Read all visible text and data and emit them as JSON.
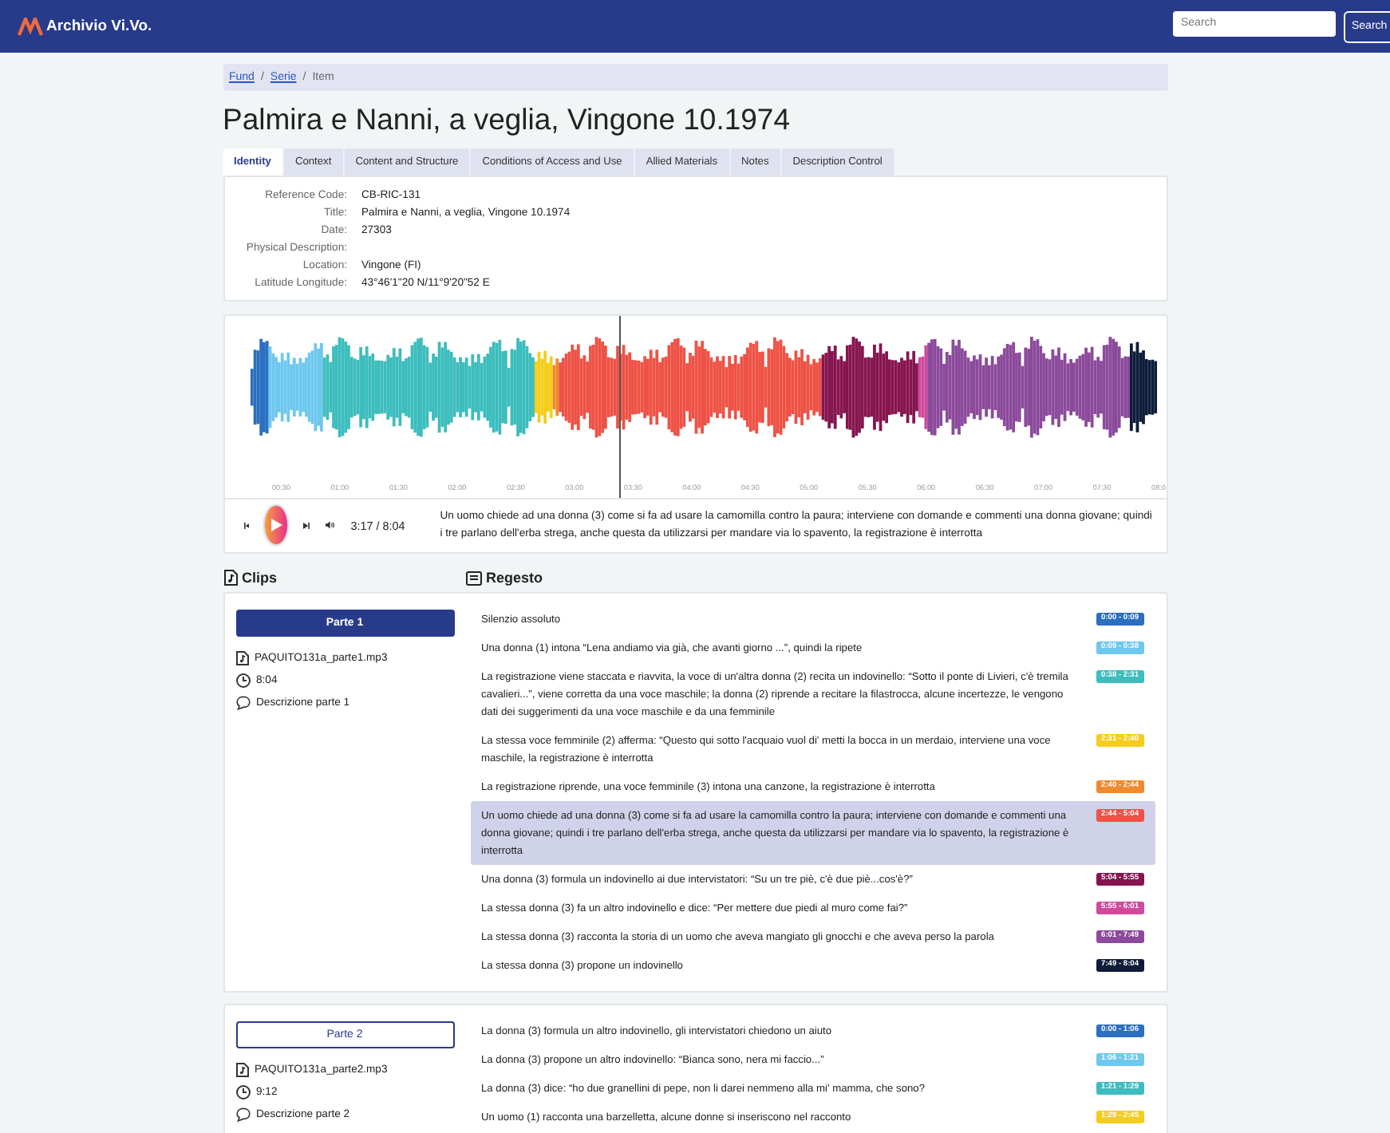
{
  "navbar": {
    "brand": "Archivio Vi.Vo.",
    "search": {
      "placeholder": "Search"
    },
    "search_button": "Search"
  },
  "breadcrumb": [
    {
      "label": "Fund",
      "link": true
    },
    {
      "separator": "/"
    },
    {
      "label": "Serie",
      "link": true
    },
    {
      "separator": "/"
    },
    {
      "label": "Item",
      "link": false
    }
  ],
  "title": "Palmira e Nanni, a veglia, Vingone 10.1974",
  "tabs": [
    {
      "label": "Identity",
      "selected": true
    },
    {
      "label": "Context",
      "selected": false
    },
    {
      "label": "Content and Structure",
      "selected": false
    },
    {
      "label": "Conditions of Access and Use",
      "selected": false
    },
    {
      "label": "Allied Materials",
      "selected": false
    },
    {
      "label": "Notes",
      "selected": false
    },
    {
      "label": "Description Control",
      "selected": false
    }
  ],
  "identity": [
    {
      "label": "Reference Code:",
      "value": "CB-RIC-131"
    },
    {
      "label": "Title:",
      "value": "Palmira e Nanni, a veglia, Vingone 10.1974"
    },
    {
      "label": "Date:",
      "value": "27303"
    },
    {
      "label": "Physical Description:"
    },
    {
      "label": "Location:",
      "value": "Vingone (FI)"
    },
    {
      "label": "Latitude Longitude:",
      "value": "43°46'1\"20 N/11°9'20\"52 E"
    }
  ],
  "player": {
    "ticks": [
      "00:30",
      "01:00",
      "01:30",
      "02:00",
      "02:30",
      "03:00",
      "03:30",
      "04:00",
      "04:30",
      "05:00",
      "05:30",
      "06:00",
      "06:30",
      "07:00",
      "07:30",
      "08:0"
    ],
    "level": 0.407,
    "time": "3:17 / 8:04",
    "caption": "Un uomo chiede ad una donna (3) come si fa ad usare la camomilla contro la paura; interviene con domande e commenti una donna giovane; quindi i tre parlano dell'erba strega, anche questa da utilizzarsi per mandare via lo spavento, la registrazione è interrotta"
  },
  "clips_heading": "Clips",
  "regesto_heading": "Regesto",
  "clips": [
    {
      "name": "Parte 1",
      "selected": true,
      "file": "PAQUITO131a_parte1.mp3",
      "duration": "8:04",
      "description": "Descrizione parte 1",
      "entries": [
        {
          "text": "Silenzio assoluto",
          "time": "0:00 - 0:09",
          "color": "#2a6fc0",
          "selected": false
        },
        {
          "text": "Una donna (1) intona “Lena andiamo via già, che avanti giorno ...”, quindi la ripete",
          "time": "0:09 - 0:38",
          "color": "#6ec8ee",
          "selected": false
        },
        {
          "text": "La registrazione viene staccata e riavvita, la voce di un'altra donna (2) recita un indovinello: “Sotto il ponte di Livieri, c'è tremila cavalieri...”, viene corretta da una voce maschile; la donna (2) riprende a recitare la filastrocca, alcune incertezze, le vengono dati dei suggerimenti da una voce maschile e da una femminile",
          "time": "0:38 - 2:31",
          "color": "#3dbdbd",
          "selected": false
        },
        {
          "text": "La stessa voce femminile (2) afferma: “Questo qui sotto l'acquaio vuol di' metti la bocca in un merdaio, interviene una voce maschile, la registrazione è interrotta",
          "time": "2:31 - 2:40",
          "color": "#f5cd1c",
          "selected": false
        },
        {
          "text": "La registrazione riprende, una voce femminile (3) intona una canzone, la registrazione è interrotta",
          "time": "2:40 - 2:44",
          "color": "#f08a30",
          "selected": false
        },
        {
          "text": "Un uomo chiede ad una donna (3) come si fa ad usare la camomilla contro la paura; interviene con domande e commenti una donna giovane; quindi i tre parlano dell'erba strega, anche questa da utilizzarsi per mandare via lo spavento, la registrazione è interrotta",
          "time": "2:44 - 5:04",
          "color": "#ee5245",
          "selected": true
        },
        {
          "text": "Una donna (3) formula un indovinello ai due intervistatori: “Su un tre piè, c'è due piè...cos'è?”",
          "time": "5:04 - 5:55",
          "color": "#86154f",
          "selected": false
        },
        {
          "text": "La stessa donna (3) fa un altro indovinello e dice: “Per mettere due piedi al muro come fai?”",
          "time": "5:55 - 6:01",
          "color": "#d04a9c",
          "selected": false
        },
        {
          "text": "La stessa donna (3) racconta la storia di un uomo che aveva mangiato gli gnocchi e che aveva perso la parola",
          "time": "6:01 - 7:49",
          "color": "#8c4a9c",
          "selected": false
        },
        {
          "text": "La stessa donna (3) propone un indovinello",
          "time": "7:49 - 8:04",
          "color": "#0e1c3a",
          "selected": false
        }
      ]
    },
    {
      "name": "Parte 2",
      "selected": false,
      "file": "PAQUITO131a_parte2.mp3",
      "duration": "9:12",
      "description": "Descrizione parte 2",
      "entries": [
        {
          "text": "La donna (3) formula un altro indovinello, gli intervistatori chiedono un aiuto",
          "time": "0:00 - 1:06",
          "color": "#2a6fc0",
          "selected": false
        },
        {
          "text": "La donna (3) propone un altro indovinello: “Bianca sono, nera mi faccio...”",
          "time": "1:06 - 1:21",
          "color": "#6ec8ee",
          "selected": false
        },
        {
          "text": "La donna (3) dice: “ho due granellini di pepe, non li darei nemmeno alla mi' mamma, che sono?",
          "time": "1:21 - 1:29",
          "color": "#3dbdbd",
          "selected": false
        },
        {
          "text": "Un uomo (1) racconta una barzelletta, alcune donne si inseriscono nel racconto",
          "time": "1:29 - 2:45",
          "color": "#f5cd1c",
          "selected": false
        }
      ]
    }
  ]
}
